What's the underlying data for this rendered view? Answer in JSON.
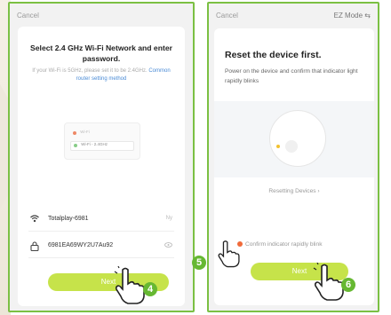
{
  "left_screen": {
    "cancel": "Cancel",
    "title": "Select 2.4 GHz Wi-Fi Network and enter password.",
    "subtitle": "If your Wi-Fi is 5GHz, please set it to be 2.4GHz.",
    "link": "Common router setting method",
    "mini_wifi_a": "Wi-Fi",
    "mini_wifi_b": "Wi-Fi - 2.4GHz",
    "network_name": "Totalplay-6981",
    "network_action": "Ny",
    "password": "6981EA69WY2U7Au92",
    "next": "Next"
  },
  "right_screen": {
    "cancel": "Cancel",
    "mode": "EZ Mode ⇆",
    "title": "Reset the device first.",
    "subtitle": "Power on the device and confirm that indicator light rapidly blinks",
    "resetting": "Resetting Devices ›",
    "confirm": "Confirm indicator rapidly blink",
    "next": "Next"
  },
  "steps": {
    "four": "4",
    "five": "5",
    "six": "6"
  },
  "colors": {
    "frame": "#7bc043",
    "button": "#c6e34a",
    "badge": "#66b832",
    "radio": "#f06a3a"
  }
}
